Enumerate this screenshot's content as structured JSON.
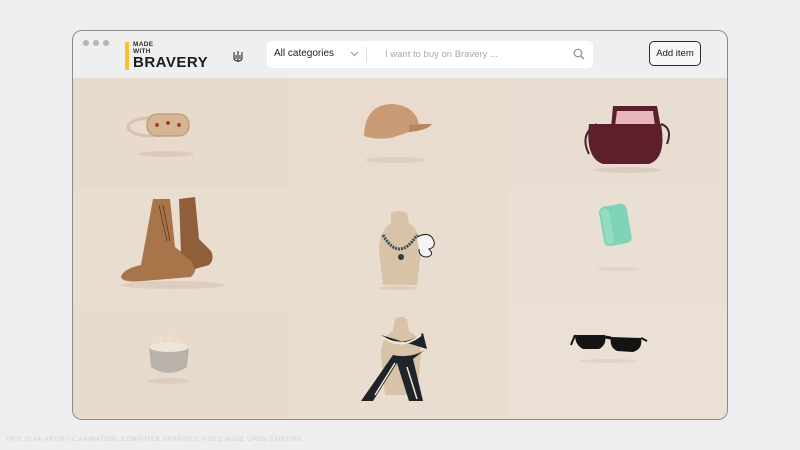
{
  "header": {
    "logo": {
      "line1": "MADE",
      "line2": "WITH",
      "wordmark": "BRAVERY"
    },
    "category_select": {
      "selected": "All categories"
    },
    "search": {
      "placeholder": "I want to buy on Bravery ..."
    },
    "add_item_label": "Add item"
  },
  "products": [
    {
      "name": "bracelet-icon",
      "color": "#d5b496"
    },
    {
      "name": "cap-icon",
      "color": "#c89a74"
    },
    {
      "name": "handbag-icon",
      "color": "#5a1f2a"
    },
    {
      "name": "boots-icon",
      "color": "#a8744a"
    },
    {
      "name": "necklace-icon",
      "color": "#3e4d56"
    },
    {
      "name": "soap-icon",
      "color": "#7fd3b8"
    },
    {
      "name": "candle-icon",
      "color": "#b8b2aa"
    },
    {
      "name": "scarf-icon",
      "color": "#1e2428"
    },
    {
      "name": "sunglasses-icon",
      "color": "#141414"
    }
  ],
  "colors": {
    "accent": "#f2c230",
    "background": "#e7d9cb",
    "topbar": "#efefef"
  },
  "footer": {
    "disclaimer": "THIS IS AN ARTISTIC ANIMATION, COMPUTER GRAPHICS VIDEO MADE UPON EXISTING"
  }
}
